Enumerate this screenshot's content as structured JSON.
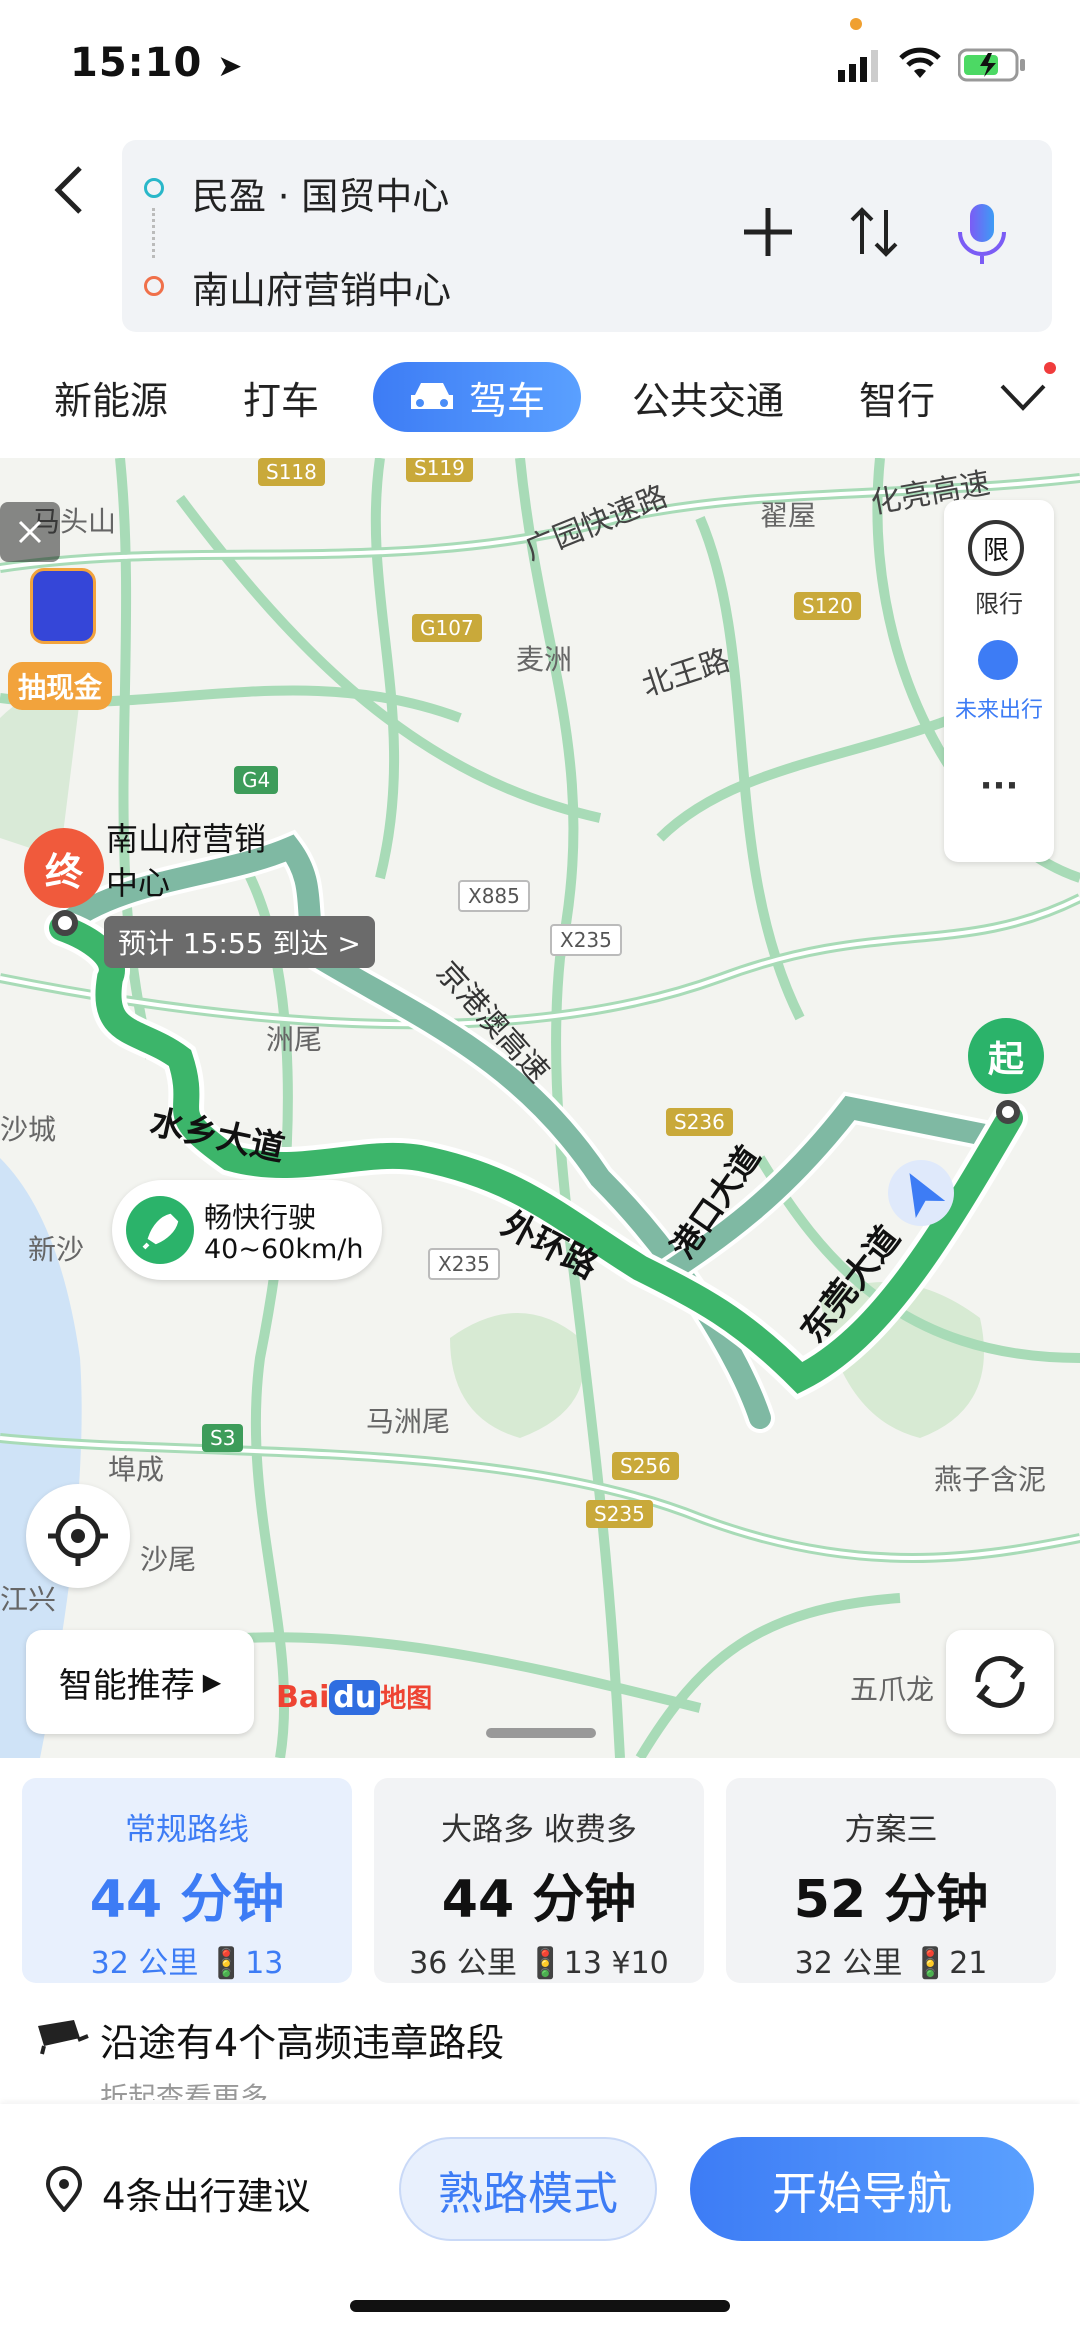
{
  "status": {
    "time": "15:10"
  },
  "route": {
    "origin": "民盈 · 国贸中心",
    "destination": "南山府营销中心"
  },
  "tabs": [
    {
      "label": "新能源"
    },
    {
      "label": "打车"
    },
    {
      "label": "驾车",
      "active": true
    },
    {
      "label": "公共交通"
    },
    {
      "label": "智行"
    }
  ],
  "map": {
    "places": [
      "马头山",
      "翟屋",
      "麦洲",
      "洲尾",
      "沙城",
      "新沙",
      "埠成",
      "沙尾",
      "马洲尾",
      "燕子含泥",
      "五爪龙",
      "江兴"
    ],
    "roads": [
      "广园快速路",
      "北王路",
      "京港澳高速",
      "水乡大道",
      "外环路",
      "港口大道",
      "东莞大道",
      "化亮高速"
    ],
    "road_badges": [
      "S118",
      "S119",
      "G107",
      "S120",
      "G4",
      "X885",
      "X235",
      "S236",
      "X235",
      "S3",
      "S256",
      "S235"
    ],
    "destination_marker": "终",
    "destination_label_1": "南山府营销",
    "destination_label_2": "中心",
    "eta": "预计 15:55 到达 >",
    "origin_marker": "起",
    "cashback": "抽现金",
    "speed_title": "畅快行驶",
    "speed_range": "40~60km/h",
    "restriction_icon": "限",
    "restriction_label": "限行",
    "future_label": "未来出行",
    "more": "···",
    "smart_recommend": "智能推荐",
    "logo_text_1": "Bai",
    "logo_text_2": "du",
    "logo_text_3": "地图"
  },
  "options": [
    {
      "title": "常规路线",
      "time": "44 分钟",
      "detail": "32 公里  🚦13"
    },
    {
      "title": "大路多  收费多",
      "time": "44 分钟",
      "detail": "36 公里  🚦13  ¥10"
    },
    {
      "title": "方案三",
      "time": "52 分钟",
      "detail": "32 公里  🚦21"
    }
  ],
  "violation": {
    "text": "沿途有4个高频违章路段",
    "sub": "折起查看更多"
  },
  "bottom": {
    "tips": "4条出行建议",
    "familiar": "熟路模式",
    "start": "开始导航"
  },
  "colors": {
    "accent": "#3d7cf5",
    "route_main": "#3cb56a",
    "route_alt": "#7fb9a3",
    "marker_red": "#f05a3c",
    "marker_green": "#2bb36a"
  }
}
